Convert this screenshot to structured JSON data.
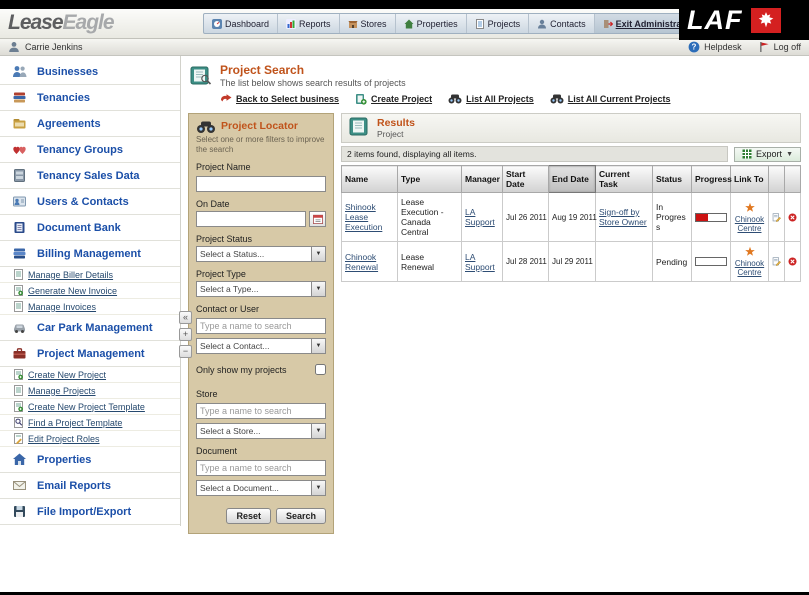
{
  "icons": {
    "collapse": "«",
    "zoom_in": "+",
    "zoom_out": "−",
    "dropdown_arrow": "▼",
    "caret_down": "▼"
  },
  "header": {
    "logo_part1": "Lease",
    "logo_part2": "Eagle",
    "brand": "LAF",
    "nav": [
      {
        "label": "Dashboard",
        "icon": "dashboard-icon"
      },
      {
        "label": "Reports",
        "icon": "reports-icon"
      },
      {
        "label": "Stores",
        "icon": "stores-icon"
      },
      {
        "label": "Properties",
        "icon": "properties-icon"
      },
      {
        "label": "Projects",
        "icon": "projects-icon"
      },
      {
        "label": "Contacts",
        "icon": "contacts-icon"
      },
      {
        "label": "Exit Administration",
        "icon": "exit-icon",
        "active": true
      }
    ]
  },
  "userbar": {
    "user": "Carrie Jenkins",
    "helpdesk": "Helpdesk",
    "logoff": "Log off"
  },
  "sidebar": {
    "items": [
      {
        "label": "Businesses",
        "icon": "businesses-icon"
      },
      {
        "label": "Tenancies",
        "icon": "tenancies-icon"
      },
      {
        "label": "Agreements",
        "icon": "agreements-icon"
      },
      {
        "label": "Tenancy Groups",
        "icon": "tenancy-groups-icon"
      },
      {
        "label": "Tenancy Sales Data",
        "icon": "tenancy-sales-data-icon"
      },
      {
        "label": "Users & Contacts",
        "icon": "users-contacts-icon"
      },
      {
        "label": "Document Bank",
        "icon": "document-bank-icon"
      },
      {
        "label": "Billing Management",
        "icon": "billing-management-icon",
        "sub": [
          {
            "label": "Manage Biller Details"
          },
          {
            "label": "Generate New Invoice"
          },
          {
            "label": "Manage Invoices"
          }
        ]
      },
      {
        "label": "Car Park Management",
        "icon": "car-park-icon"
      },
      {
        "label": "Project Management",
        "icon": "project-management-icon",
        "sub": [
          {
            "label": "Create New Project"
          },
          {
            "label": "Manage Projects"
          },
          {
            "label": "Create New Project Template"
          },
          {
            "label": "Find a Project Template"
          },
          {
            "label": "Edit Project Roles"
          }
        ]
      },
      {
        "label": "Properties",
        "icon": "properties-house-icon"
      },
      {
        "label": "Email Reports",
        "icon": "email-reports-icon"
      },
      {
        "label": "File Import/Export",
        "icon": "file-import-export-icon"
      }
    ]
  },
  "page": {
    "title": "Project Search",
    "subtitle": "The list below shows search results of projects",
    "actions": [
      {
        "label": "Back to Select business",
        "icon": "back-arrow-icon"
      },
      {
        "label": "Create Project",
        "icon": "create-project-icon"
      },
      {
        "label": "List All Projects",
        "icon": "binoculars-icon"
      },
      {
        "label": "List All Current Projects",
        "icon": "binoculars-icon"
      }
    ]
  },
  "locator": {
    "title": "Project Locator",
    "subtitle": "Select one or more filters to improve the search",
    "project_name_label": "Project Name",
    "on_date_label": "On Date",
    "project_status_label": "Project Status",
    "project_status_value": "Select a Status...",
    "project_type_label": "Project Type",
    "project_type_value": "Select a Type...",
    "contact_label": "Contact or User",
    "contact_placeholder": "Type a name to search",
    "contact_value": "Select a Contact...",
    "only_mine_label": "Only show my projects",
    "store_label": "Store",
    "store_placeholder": "Type a name to search",
    "store_value": "Select a Store...",
    "document_label": "Document",
    "document_placeholder": "Type a name to search",
    "document_value": "Select a Document...",
    "reset_label": "Reset",
    "search_label": "Search"
  },
  "results": {
    "title": "Results",
    "subtitle": "Project",
    "status": "2 items found, displaying all items.",
    "export_label": "Export",
    "columns": [
      "Name",
      "Type",
      "Manager",
      "Start Date",
      "End Date",
      "Current Task",
      "Status",
      "Progress",
      "Link To"
    ],
    "rows": [
      {
        "name": "Shinook Lease Execution",
        "type": "Lease Execution - Canada Central",
        "manager": "LA Support",
        "start_date": "Jul 26 2011",
        "end_date": "Aug 19 2011",
        "current_task": "Sign-off by Store Owner",
        "status": "In Progress",
        "progress_pct": 40,
        "link_to": "Chinook Centre"
      },
      {
        "name": "Chinook Renewal",
        "type": "Lease Renewal",
        "manager": "LA Support",
        "start_date": "Jul 28 2011",
        "end_date": "Jul 29 2011",
        "current_task": "",
        "status": "Pending",
        "progress_pct": 0,
        "link_to": "Chinook Centre"
      }
    ]
  }
}
